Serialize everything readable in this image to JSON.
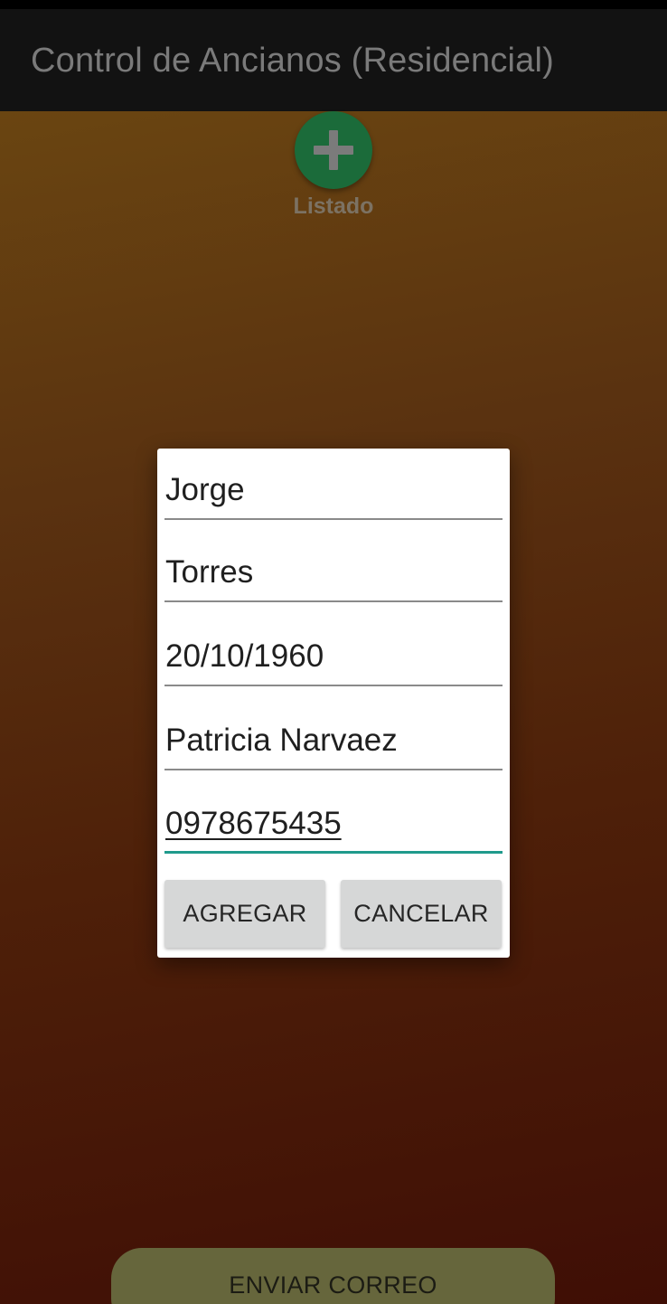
{
  "app_bar": {
    "title": "Control de Ancianos (Residencial)"
  },
  "fab": {
    "icon": "plus-icon",
    "label": "Listado",
    "color": "#1b6b3a"
  },
  "dialog": {
    "fields": [
      {
        "value": "Jorge"
      },
      {
        "value": "Torres"
      },
      {
        "value": "20/10/1960"
      },
      {
        "value": "Patricia Narvaez"
      },
      {
        "value": "0978675435"
      }
    ],
    "focused_field_index": 4,
    "accent_color": "#1f9a8c",
    "buttons": {
      "add_label": "AGREGAR",
      "cancel_label": "CANCELAR"
    }
  },
  "bottom": {
    "send_label": "ENVIAR CORREO",
    "send_color": "#66663c"
  }
}
